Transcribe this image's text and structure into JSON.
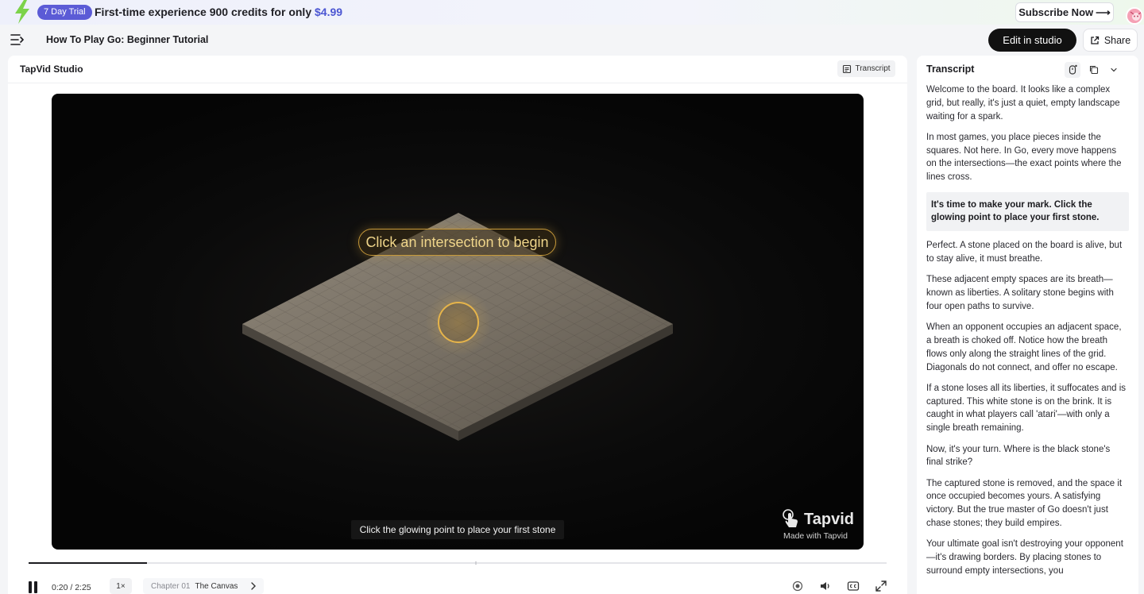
{
  "promo": {
    "badge": "7 Day Trial",
    "message": "First-time experience 900 credits for only ",
    "price": "$4.99",
    "subscribe_label": "Subscribe Now",
    "subscribe_arrow": "⟶",
    "bolt_color": "#7cd34a"
  },
  "header": {
    "title": "How To Play Go: Beginner Tutorial",
    "edit_label": "Edit in studio",
    "share_label": "Share"
  },
  "studio": {
    "name": "TapVid Studio",
    "transcript_button": "Transcript"
  },
  "video": {
    "callout": "Click an intersection to begin",
    "caption": "Click the glowing point to place your first stone",
    "brand_name": "Tapvid",
    "brand_tagline": "Made with Tapvid",
    "accent_color": "#e6b44a"
  },
  "player": {
    "time": "0:20 / 2:25",
    "progress_percent": 13.8,
    "speed": "1×",
    "chapter_label": "Chapter 01",
    "chapter_name": "The Canvas"
  },
  "transcript": {
    "title": "Transcript",
    "paragraphs": [
      "Welcome to the board. It looks like a complex grid, but really, it's just a quiet, empty landscape waiting for a spark.",
      "In most games, you place pieces inside the squares. Not here. In Go, every move happens on the intersections—the exact points where the lines cross.",
      "It's time to make your mark. Click the glowing point to place your first stone.",
      "Perfect. A stone placed on the board is alive, but to stay alive, it must breathe.",
      "These adjacent empty spaces are its breath—known as liberties. A solitary stone begins with four open paths to survive.",
      "When an opponent occupies an adjacent space, a breath is choked off. Notice how the breath flows only along the straight lines of the grid. Diagonals do not connect, and offer no escape.",
      "If a stone loses all its liberties, it suffocates and is captured. This white stone is on the brink. It is caught in what players call 'atari'—with only a single breath remaining.",
      "Now, it's your turn. Where is the black stone's final strike?",
      "The captured stone is removed, and the space it once occupied becomes yours. A satisfying victory. But the true master of Go doesn't just chase stones; they build empires.",
      "Your ultimate goal isn't destroying your opponent—it's drawing borders. By placing stones to surround empty intersections, you"
    ],
    "active_index": 2
  }
}
